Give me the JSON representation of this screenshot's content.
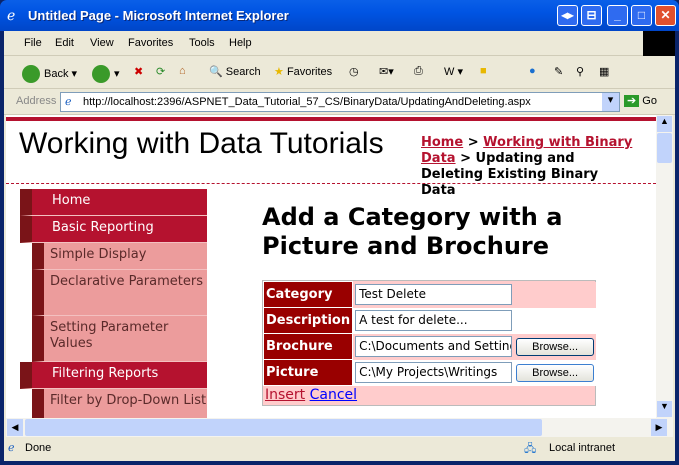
{
  "window": {
    "title": "Untitled Page - Microsoft Internet Explorer"
  },
  "menu": [
    "File",
    "Edit",
    "View",
    "Favorites",
    "Tools",
    "Help"
  ],
  "toolbar": {
    "back": "Back",
    "search": "Search",
    "favorites": "Favorites"
  },
  "address": {
    "label": "Address",
    "url": "http://localhost:2396/ASPNET_Data_Tutorial_57_CS/BinaryData/UpdatingAndDeleting.aspx",
    "go": "Go"
  },
  "page": {
    "site_title": "Working with Data Tutorials",
    "breadcrumb": {
      "home": "Home",
      "sep": ">",
      "section": "Working with Binary Data",
      "current": "Updating and Deleting Existing Binary Data"
    },
    "sidebar": [
      {
        "label": "Home",
        "level": 1
      },
      {
        "label": "Basic Reporting",
        "level": 1
      },
      {
        "label": "Simple Display",
        "level": 2
      },
      {
        "label": "Declarative Parameters",
        "level": 2
      },
      {
        "label": "Setting Parameter Values",
        "level": 2
      },
      {
        "label": "Filtering Reports",
        "level": 1
      },
      {
        "label": "Filter by Drop-Down List",
        "level": 2
      }
    ],
    "heading": "Add a Category with a Picture and Brochure",
    "form": {
      "rows": [
        {
          "label": "Category",
          "value": "Test Delete"
        },
        {
          "label": "Description",
          "value": "A test for delete..."
        },
        {
          "label": "Brochure",
          "value": "C:\\Documents and Settings",
          "button": "Browse..."
        },
        {
          "label": "Picture",
          "value": "C:\\My Projects\\Writings",
          "button": "Browse..."
        }
      ],
      "insert": "Insert",
      "cancel": "Cancel"
    }
  },
  "status": {
    "text": "Done",
    "zone": "Local intranet"
  },
  "colors": {
    "accent": "#B5122F",
    "label_bg": "#990000",
    "row_bg": "#FFCCCC",
    "sub_bg": "#EC9C9C"
  }
}
